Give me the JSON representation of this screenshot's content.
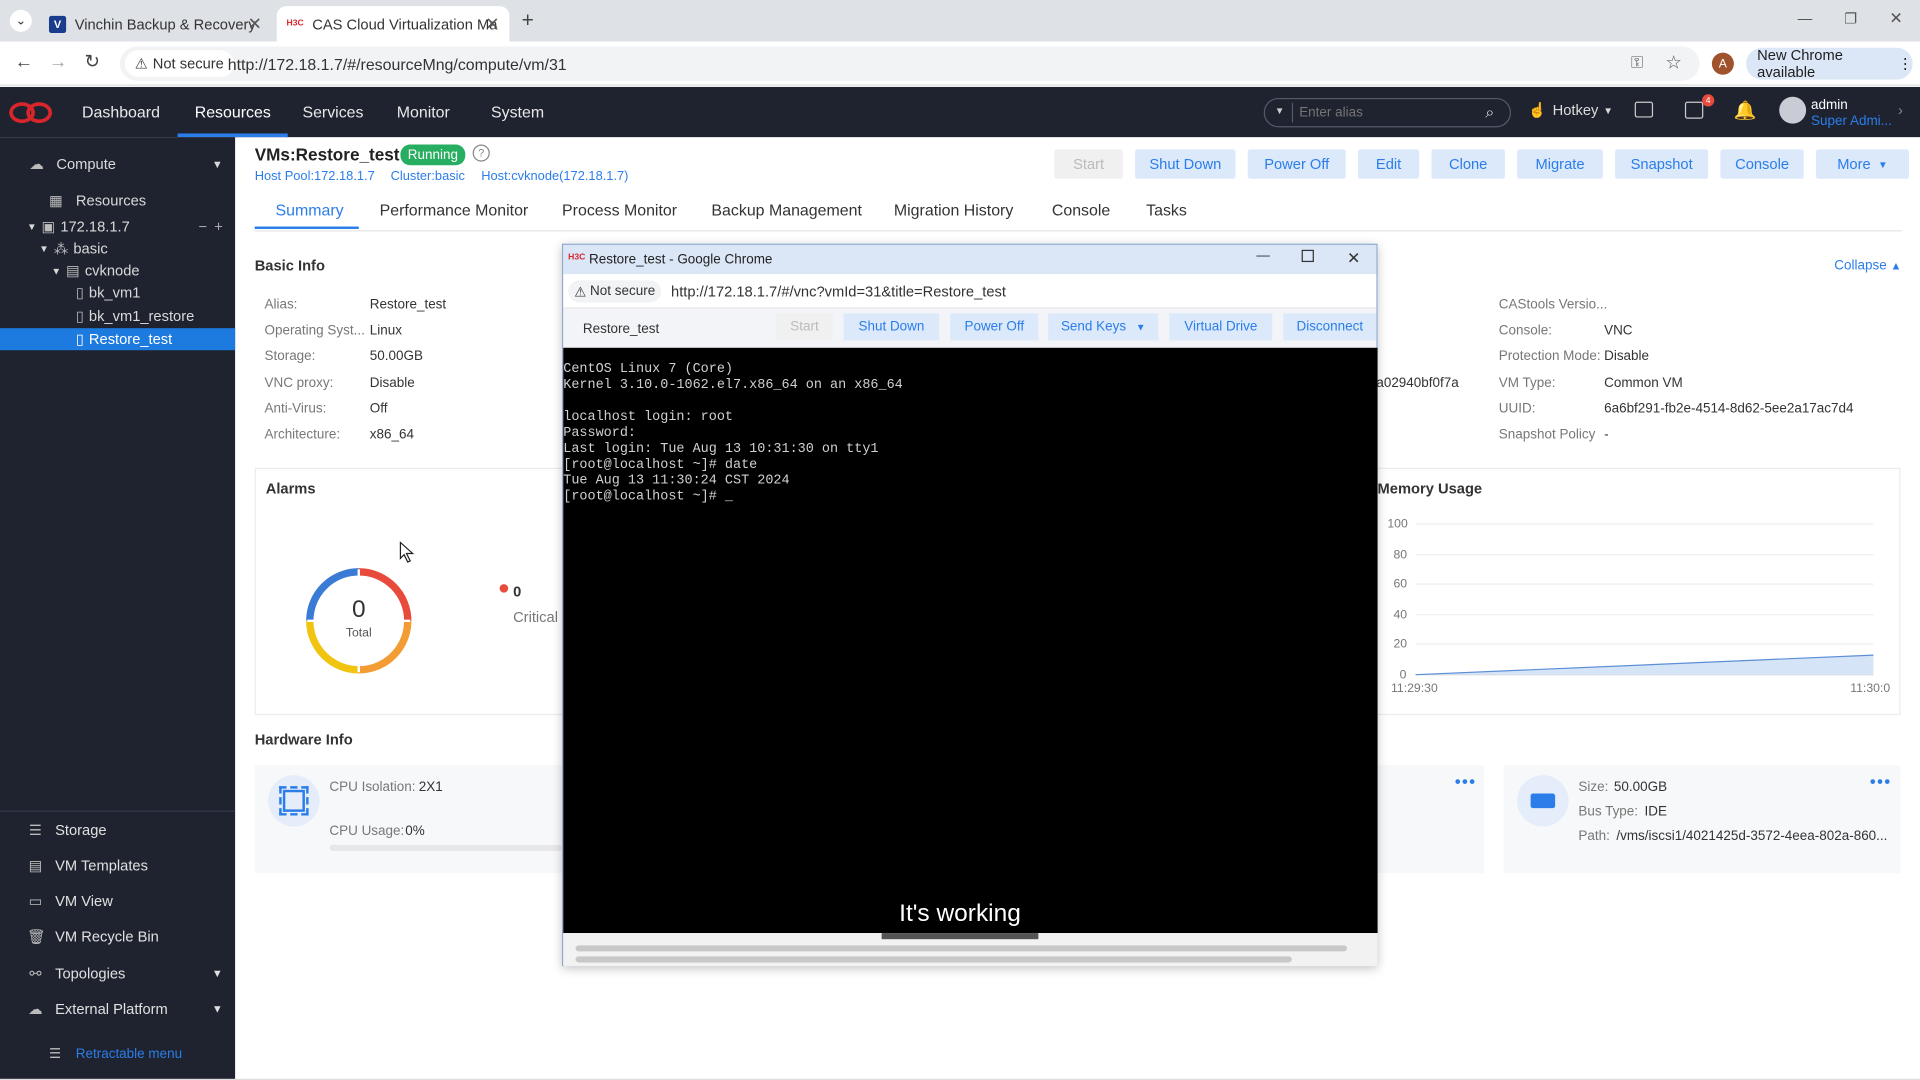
{
  "browser": {
    "tabs": [
      {
        "title": "Vinchin Backup & Recovery",
        "favicon": "V"
      },
      {
        "title": "CAS Cloud Virtualization Ma",
        "favicon": "H3C"
      }
    ],
    "security_label": "Not secure",
    "url": "http://172.18.1.7/#/resourceMng/compute/vm/31",
    "profile_initial": "A",
    "update_label": "New Chrome available"
  },
  "header": {
    "nav": [
      "Dashboard",
      "Resources",
      "Services",
      "Monitor",
      "System"
    ],
    "search_placeholder": "Enter alias",
    "hotkey_label": "Hotkey",
    "user_name": "admin",
    "user_role": "Super Admi...",
    "badge_count": "4"
  },
  "sidebar": {
    "compute_label": "Compute",
    "resources_label": "Resources",
    "tree": [
      {
        "label": "172.18.1.7",
        "level": 0
      },
      {
        "label": "basic",
        "level": 1
      },
      {
        "label": "cvknode",
        "level": 2
      },
      {
        "label": "bk_vm1",
        "level": 3
      },
      {
        "label": "bk_vm1_restore",
        "level": 3
      },
      {
        "label": "Restore_test",
        "level": 3,
        "selected": true
      }
    ],
    "bottom_items": [
      "Storage",
      "VM Templates",
      "VM View",
      "VM Recycle Bin",
      "Topologies",
      "External Platform"
    ],
    "retract_label": "Retractable menu"
  },
  "vm": {
    "title": "VMs:Restore_test",
    "status": "Running",
    "host_pool": "Host Pool:172.18.1.7",
    "cluster": "Cluster:basic",
    "host": "Host:cvknode(172.18.1.7)",
    "actions": [
      "Start",
      "Shut Down",
      "Power Off",
      "Edit",
      "Clone",
      "Migrate",
      "Snapshot",
      "Console",
      "More"
    ],
    "tabs": [
      "Summary",
      "Performance Monitor",
      "Process Monitor",
      "Backup Management",
      "Migration History",
      "Console",
      "Tasks"
    ]
  },
  "basic_info": {
    "title": "Basic Info",
    "collapse_label": "Collapse",
    "left": [
      {
        "label": "Alias:",
        "value": "Restore_test"
      },
      {
        "label": "Operating Syst...",
        "value": "Linux"
      },
      {
        "label": "Storage:",
        "value": "50.00GB"
      },
      {
        "label": "VNC proxy:",
        "value": "Disable"
      },
      {
        "label": "Anti-Virus:",
        "value": "Off"
      },
      {
        "label": "Architecture:",
        "value": "x86_64"
      }
    ],
    "partial_value": "a02940bf0f7a",
    "right": [
      {
        "label": "CAStools Versio...",
        "value": ""
      },
      {
        "label": "Console:",
        "value": "VNC"
      },
      {
        "label": "Protection Mode:",
        "value": "Disable"
      },
      {
        "label": "VM Type:",
        "value": "Common VM"
      },
      {
        "label": "UUID:",
        "value": "6a6bf291-fb2e-4514-8d62-5ee2a17ac7d4"
      },
      {
        "label": "Snapshot Policy",
        "value": "-"
      }
    ]
  },
  "alarms": {
    "title": "Alarms",
    "total": "0",
    "total_label": "Total",
    "critical_count": "0",
    "critical_label": "Critical",
    "colors": [
      "#e84b3c",
      "#f39c33",
      "#f1c40f",
      "#3a7bd5"
    ]
  },
  "memory": {
    "title": "Memory Usage",
    "y_ticks": [
      "100",
      "80",
      "60",
      "40",
      "20",
      "0"
    ],
    "x_ticks": [
      "11:29:30",
      "11:30:0"
    ]
  },
  "hardware": {
    "title": "Hardware Info",
    "cpu_isolation_label": "CPU Isolation:",
    "cpu_isolation_value": "2X1",
    "cpu_usage_label": "CPU Usage:",
    "cpu_usage_value": "0%",
    "disk_size_label": "Size:",
    "disk_size_value": "50.00GB",
    "disk_bus_label": "Bus Type:",
    "disk_bus_value": "IDE",
    "disk_path_label": "Path:",
    "disk_path_value": "/vms/iscsi1/4021425d-3572-4eea-802a-860..."
  },
  "popup": {
    "window_title": "Restore_test - Google Chrome",
    "security_label": "Not secure",
    "url": "http://172.18.1.7/#/vnc?vmId=31&title=Restore_test",
    "vm_name": "Restore_test",
    "buttons": [
      "Start",
      "Shut Down",
      "Power Off",
      "Send Keys",
      "Virtual Drive",
      "Disconnect"
    ],
    "terminal": "CentOS Linux 7 (Core)\nKernel 3.10.0-1062.el7.x86_64 on an x86_64\n\nlocalhost login: root\nPassword:\nLast login: Tue Aug 13 10:31:30 on tty1\n[root@localhost ~]# date\nTue Aug 13 11:30:24 CST 2024\n[root@localhost ~]# _"
  },
  "caption": "It's working"
}
